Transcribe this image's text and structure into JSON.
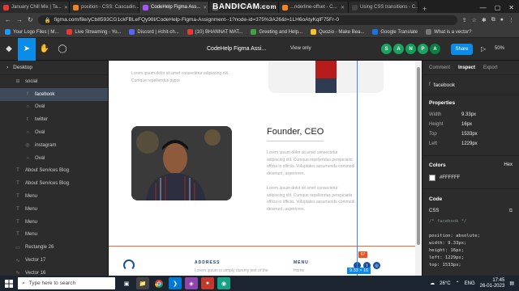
{
  "browser": {
    "tabs": [
      {
        "label": "January Chill Mix | Ta...",
        "color": "#e53935"
      },
      {
        "label": "position - CSS: Cascadin...",
        "color": "#f48024"
      },
      {
        "label": "CodeHelp Figma Ass...",
        "color": "#a259ff",
        "active": true
      },
      {
        "label": "www.BANDICAM.com",
        "color": "#7a7a7a"
      },
      {
        "label": "...nderline-offset - C...",
        "color": "#f48024"
      },
      {
        "label": "Using CSS transitions - C...",
        "color": "#444444"
      }
    ],
    "new_tab": "+",
    "url": "figma.com/file/yCb8593CG1ckFBLeFQy98l/CodeHelp-Figma-Assignment--1?node-id=375%3A26&t=1LH6oAtyKqlF75Fr-0",
    "bookmarks": [
      {
        "label": "Your Logo Files | M...",
        "color": "#2196f3"
      },
      {
        "label": "Live Streaming - Yo...",
        "color": "#e53935"
      },
      {
        "label": "Discord | #chit-ch...",
        "color": "#5865f2"
      },
      {
        "label": "(10) BHANNAT MAT...",
        "color": "#e53935"
      },
      {
        "label": "Greeting and Help...",
        "color": "#43a047"
      },
      {
        "label": "Quozio - Make Bea...",
        "color": "#fbc02d"
      },
      {
        "label": "Google Translate",
        "color": "#1a73e8"
      },
      {
        "label": "What is a vector?",
        "color": "#777777"
      }
    ],
    "watermark_main": "BANDICAM",
    "watermark_suffix": ".com"
  },
  "figma": {
    "title": "CodeHelp Figma Assi...",
    "view_only": "View only",
    "avatars": [
      {
        "letter": "S",
        "color": "#1aa260"
      },
      {
        "letter": "A",
        "color": "#1aa260"
      },
      {
        "letter": "N",
        "color": "#0f9d58"
      },
      {
        "letter": "P",
        "color": "#1aa260"
      },
      {
        "letter": "A",
        "color": "#0b8043"
      }
    ],
    "share": "Share",
    "zoom": "50%",
    "page": "Desktop",
    "layers": [
      {
        "label": "social",
        "indent": 1,
        "icon": "⊞"
      },
      {
        "label": "facebook",
        "indent": 2,
        "icon": "f",
        "selected": true
      },
      {
        "label": "Oval",
        "indent": 2,
        "icon": "○"
      },
      {
        "label": "twitter",
        "indent": 2,
        "icon": "t"
      },
      {
        "label": "Oval",
        "indent": 2,
        "icon": "○"
      },
      {
        "label": "instagram",
        "indent": 2,
        "icon": "◎"
      },
      {
        "label": "Oval",
        "indent": 2,
        "icon": "○"
      },
      {
        "label": "About Services Blog",
        "indent": 1,
        "icon": "T"
      },
      {
        "label": "About Services Blog",
        "indent": 1,
        "icon": "T"
      },
      {
        "label": "Menu",
        "indent": 1,
        "icon": "T"
      },
      {
        "label": "Menu",
        "indent": 1,
        "icon": "T"
      },
      {
        "label": "Menu",
        "indent": 1,
        "icon": "T"
      },
      {
        "label": "Menu",
        "indent": 1,
        "icon": "T"
      },
      {
        "label": "Rectangle 26",
        "indent": 1,
        "icon": "▭"
      },
      {
        "label": "Vector 17",
        "indent": 1,
        "icon": "∿"
      },
      {
        "label": "Vector 16",
        "indent": 1,
        "icon": "∿"
      }
    ]
  },
  "canvas": {
    "lorem_top": [
      "Lorem ipsum dolor sit amet consectetur adipiscing elit.",
      "Cumque repellendus pypor"
    ],
    "role": "Founder, CEO",
    "lorem_right_1": [
      "Lorem ipsum dolor sit amet consectetur",
      "adipiscing elit. Cumque repellendus perspiciatis",
      "officia in officiis. Voluptates assumenda commodi",
      "deserunt, asperiores."
    ],
    "lorem_right_2": [
      "Lorem ipsum dolor sit amet consectetur",
      "adipiscing elit. Cumque repellendus perspiciatis",
      "officia in officiis. Voluptates assumenda commodi",
      "deserunt, asperiores."
    ],
    "footer_address": "ADDRESS",
    "footer_menu": "MENU",
    "footer_lorem": "Lorem ipsum is simply dummy text of the",
    "footer_item": "Home",
    "badge": "67",
    "dimensions": "9.33 × 16"
  },
  "inspect": {
    "tabs": [
      "Comment",
      "Inspect",
      "Export"
    ],
    "active_tab": "Inspect",
    "selected": "facebook",
    "properties_title": "Properties",
    "properties": [
      {
        "k": "Width",
        "v": "9.33px"
      },
      {
        "k": "Height",
        "v": "16px"
      },
      {
        "k": "Top",
        "v": "1533px"
      },
      {
        "k": "Left",
        "v": "1229px"
      }
    ],
    "colors_title": "Colors",
    "color_format": "Hex",
    "color_value": "#FFFFFF",
    "code_title": "Code",
    "code_lang": "CSS",
    "code_lines": [
      {
        "text": "/* facebook */",
        "color": "#7f8c8d"
      },
      {
        "text": "",
        "color": "#ddd"
      },
      {
        "text": "position: absolute;",
        "color": "#ddd"
      },
      {
        "text": "width: 9.33px;",
        "color": "#ddd"
      },
      {
        "text": "height: 16px;",
        "color": "#ddd"
      },
      {
        "text": "left: 1229px;",
        "color": "#ddd"
      },
      {
        "text": "top: 1533px;",
        "color": "#ddd"
      }
    ]
  },
  "taskbar": {
    "search": "Type here to search",
    "weather": "26°C",
    "time": "17:45",
    "date": "26-01-2023",
    "lang": "ENG"
  }
}
